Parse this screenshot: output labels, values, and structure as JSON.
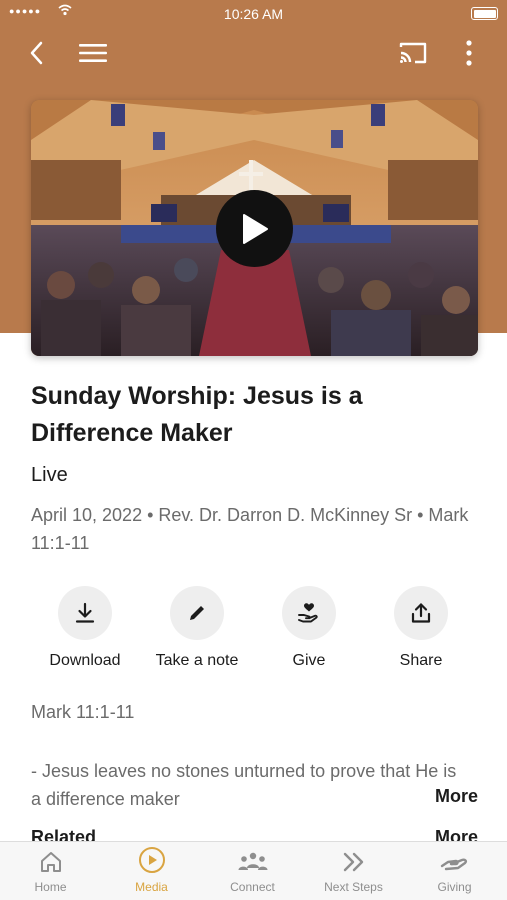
{
  "status_bar": {
    "time": "10:26 AM",
    "signal": "●●●●●"
  },
  "nav": {
    "back_icon": "chevron-left-icon",
    "menu_icon": "hamburger-icon",
    "cast_icon": "cast-icon",
    "more_icon": "more-vertical-icon"
  },
  "colors": {
    "hero_background": "#b87a4c",
    "accent": "#d9a441",
    "muted_text": "#6b6b6b"
  },
  "video": {
    "play_icon": "play-icon"
  },
  "sermon": {
    "title": "Sunday Worship: Jesus is a Difference Maker",
    "status": "Live",
    "meta": "April 10, 2022 • Rev. Dr. Darron D. McKinney Sr • Mark 11:1-11",
    "scripture": "Mark 11:1-11",
    "description": "- Jesus leaves no stones unturned to prove that He is a difference maker",
    "more_label": "More"
  },
  "actions": [
    {
      "label": "Download",
      "icon": "download-icon"
    },
    {
      "label": "Take a note",
      "icon": "pencil-icon"
    },
    {
      "label": "Give",
      "icon": "give-heart-hand-icon"
    },
    {
      "label": "Share",
      "icon": "share-icon"
    }
  ],
  "related": {
    "heading": "Related",
    "more_label": "More"
  },
  "tabs": [
    {
      "label": "Home",
      "icon": "home-icon",
      "active": false
    },
    {
      "label": "Media",
      "icon": "play-circle-icon",
      "active": true
    },
    {
      "label": "Connect",
      "icon": "group-icon",
      "active": false
    },
    {
      "label": "Next Steps",
      "icon": "double-chevron-right-icon",
      "active": false
    },
    {
      "label": "Giving",
      "icon": "giving-hand-icon",
      "active": false
    }
  ]
}
